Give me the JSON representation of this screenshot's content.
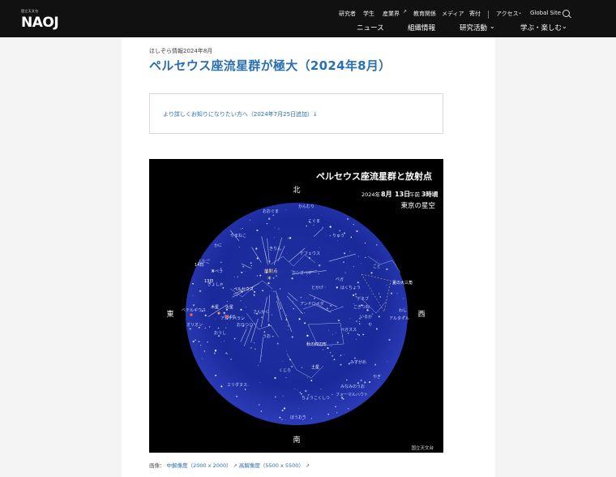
{
  "header": {
    "logo_small": "国立天文台",
    "logo": "NAOJ",
    "utility": [
      "研究者",
      "学生",
      "産業界",
      "教育関係",
      "メディア",
      "寄付",
      "アクセス",
      "Global Site"
    ],
    "main_nav": [
      "ニュース",
      "組織情報",
      "研究活動",
      "学ぶ・楽しむ"
    ]
  },
  "article": {
    "kicker": "ほしぞら情報2024年8月",
    "title": "ペルセウス座流星群が極大（2024年8月）",
    "info_link": "より詳しくお知りになりたい方へ（2024年7月25日追加）↓"
  },
  "sky_map": {
    "title": "ペルセウス座流星群と放射点",
    "date_year": "2024年",
    "date_month": "8月",
    "date_day": "13日",
    "time_am": "午前",
    "time_hour": "3時頃",
    "location": "東京の星空",
    "north": "北",
    "south": "南",
    "east": "東",
    "west": "西",
    "radiant": "放射点",
    "credit": "国立天文台",
    "labels": {
      "kitanokanmuri": "かんむり",
      "kuma": "こぐま",
      "oguma": "おおぐま",
      "kirin": "きりん",
      "yamaneko": "やまねこ",
      "kashiopeia": "カシオペヤ",
      "kefeus": "ケフェウス",
      "ryu": "りゅう",
      "kotoza": "こと",
      "hakucho": "はくちょう",
      "washi": "わし",
      "perseus": "ペルセウス",
      "andromeda": "アンドロメダ",
      "sankaku": "さんかく",
      "ohitsuji": "おひつじ",
      "uo": "うお",
      "pegasus": "ペガスス",
      "kujira": "くじら",
      "mizugame": "みずがめ",
      "yagi": "やぎ",
      "minami": "みなみのうお",
      "choukokushitsu": "ちょうこくしつ",
      "houou": "ほうおう",
      "eridanus": "エリダヌス",
      "orion": "オリオン",
      "oushi": "おうし",
      "gyosha": "ぎょしゃ",
      "futago": "ふたご",
      "kaniza": "かに",
      "natsu": "夏の大三角",
      "aki": "秋の四辺形",
      "pleiades": "すばる",
      "jupiter": "木星",
      "mars": "火星",
      "saturn": "土星",
      "day14": "14日",
      "day13": "13日",
      "deneb": "デネブ",
      "vega": "ベガ",
      "altair": "アルタイル",
      "aldebaran": "アルデバラン",
      "betelgeuse": "ベテルギウス",
      "fomalhaut": "フォーマルハウト",
      "capella": "カペラ",
      "iruka": "いるか",
      "kogitsune": "こぎつね",
      "tokage": "とかげ",
      "ya": "や",
      "iru": "いるか"
    }
  },
  "caption": {
    "prefix": "画像：",
    "mid": "中解像度（2000 x 2000）",
    "high": "高解像度（5500 x 5500）"
  }
}
